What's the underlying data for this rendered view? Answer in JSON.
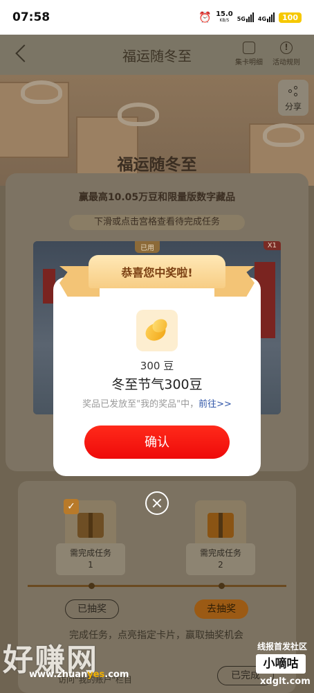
{
  "status_bar": {
    "time": "07:58",
    "speed_value": "15.0",
    "speed_unit": "KB/S",
    "network_1": "5G",
    "network_2": "4G",
    "battery": "100"
  },
  "header": {
    "title": "福运随冬至",
    "card_detail_label": "集卡明细",
    "rules_label": "活动规则"
  },
  "page": {
    "share_label": "分享",
    "main_title": "福运随冬至",
    "subtitle": "赢最高10.05万豆和限量版数字藏品",
    "hint": "下滑或点击宫格查看待完成任务",
    "card_used_tag": "已用",
    "card_count_tag": "X1"
  },
  "tasks": {
    "task_1_label": "需完成任务",
    "task_1_num": "1",
    "task_2_label": "需完成任务",
    "task_2_num": "2",
    "drawn_label": "已抽奖",
    "go_draw_label": "去抽奖",
    "description": "完成任务，点亮指定卡片，赢取抽奖机会",
    "visit_text": "访问\"我的账户\"栏目",
    "done_label": "已完成"
  },
  "modal": {
    "ribbon_title": "恭喜您中奖啦!",
    "prize_amount": "300 豆",
    "prize_name": "冬至节气300豆",
    "note_text": "奖品已发放至\"我的奖品\"中，",
    "note_link": "前往>>",
    "confirm_label": "确认"
  },
  "watermark": {
    "left_brand": "好赚网",
    "left_url_a": "www.zhuan",
    "left_url_b": "yes",
    "left_url_c": ".com",
    "right_top": "线报首发社区",
    "right_box": "小嘀咕",
    "right_url": "xdglt.com"
  },
  "colors": {
    "accent_red": "#ee0a0a",
    "ribbon_gold": "#f7cd84",
    "link_blue": "#2f55a8"
  }
}
